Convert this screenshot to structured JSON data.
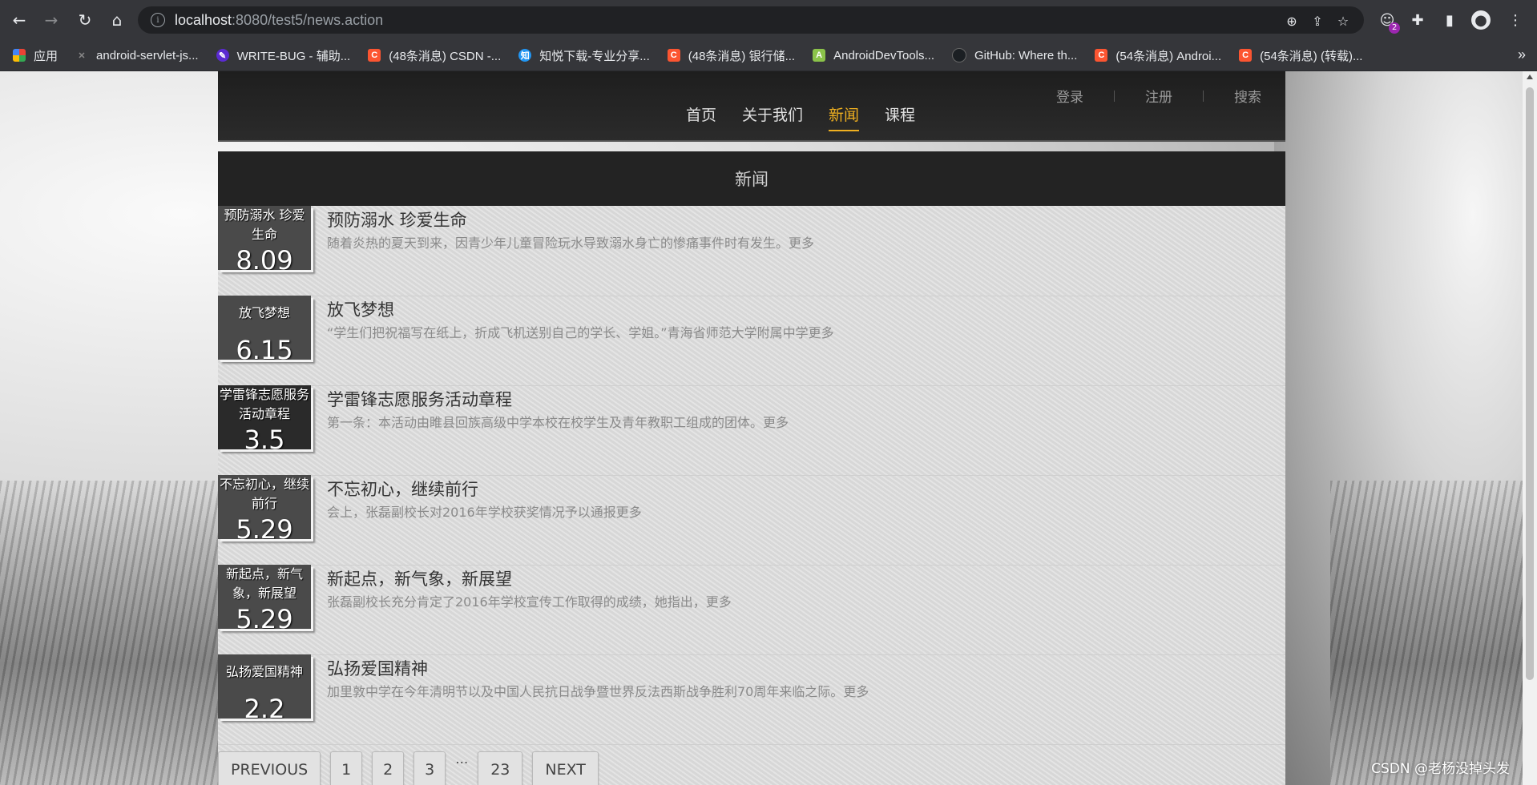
{
  "browser": {
    "url_host": "localhost",
    "url_rest": ":8080/test5/news.action",
    "extension_badge": "2",
    "bookmarks": [
      {
        "label": "应用",
        "icon": "apps-grid-icon"
      },
      {
        "label": "android-servlet-js...",
        "icon": "x-icon"
      },
      {
        "label": "WRITE-BUG - 辅助...",
        "icon": "writebug-icon"
      },
      {
        "label": "(48条消息) CSDN -...",
        "icon": "csdn-icon"
      },
      {
        "label": "知悦下载-专业分享...",
        "icon": "zhiyue-icon"
      },
      {
        "label": "(48条消息) 银行储...",
        "icon": "csdn-icon"
      },
      {
        "label": "AndroidDevTools...",
        "icon": "androiddevtools-icon"
      },
      {
        "label": "GitHub: Where th...",
        "icon": "github-icon"
      },
      {
        "label": "(54条消息) Androi...",
        "icon": "csdn-icon"
      },
      {
        "label": "(54条消息) (转载)...",
        "icon": "csdn-icon"
      }
    ]
  },
  "header": {
    "top_links": [
      "登录",
      "注册",
      "搜索"
    ],
    "nav": [
      "首页",
      "关于我们",
      "新闻",
      "课程"
    ],
    "active_nav": "新闻"
  },
  "section": {
    "title": "新闻"
  },
  "news": [
    {
      "box_title": "预防溺水 珍爱生命",
      "date": "8.09",
      "title": "预防溺水 珍爱生命",
      "desc": "随着炎热的夏天到来，因青少年儿童冒险玩水导致溺水身亡的惨痛事件时有发生。更多"
    },
    {
      "box_title": "放飞梦想",
      "date": "6.15",
      "title": "放飞梦想",
      "desc": "“学生们把祝福写在纸上，折成飞机送别自己的学长、学姐。”青海省师范大学附属中学更多"
    },
    {
      "box_title": "学雷锋志愿服务活动章程",
      "date": "3.5",
      "title": "学雷锋志愿服务活动章程",
      "desc": "第一条：本活动由睢县回族高级中学本校在校学生及青年教职工组成的团体。更多"
    },
    {
      "box_title": "不忘初心，继续前行",
      "date": "5.29",
      "title": "不忘初心，继续前行",
      "desc": "会上，张磊副校长对2016年学校获奖情况予以通报更多"
    },
    {
      "box_title": "新起点，新气象，新展望",
      "date": "5.29",
      "title": "新起点，新气象，新展望",
      "desc": "张磊副校长充分肯定了2016年学校宣传工作取得的成绩，她指出，更多"
    },
    {
      "box_title": "弘扬爱国精神",
      "date": "2.2",
      "title": "弘扬爱国精神",
      "desc": "加里敦中学在今年清明节以及中国人民抗日战争暨世界反法西斯战争胜利70周年来临之际。更多"
    }
  ],
  "pagination": {
    "previous": "PREVIOUS",
    "pages": [
      "1",
      "2",
      "3"
    ],
    "ellipsis": "…",
    "last": "23",
    "next": "NEXT"
  },
  "watermark": "CSDN @老杨没掉头发"
}
